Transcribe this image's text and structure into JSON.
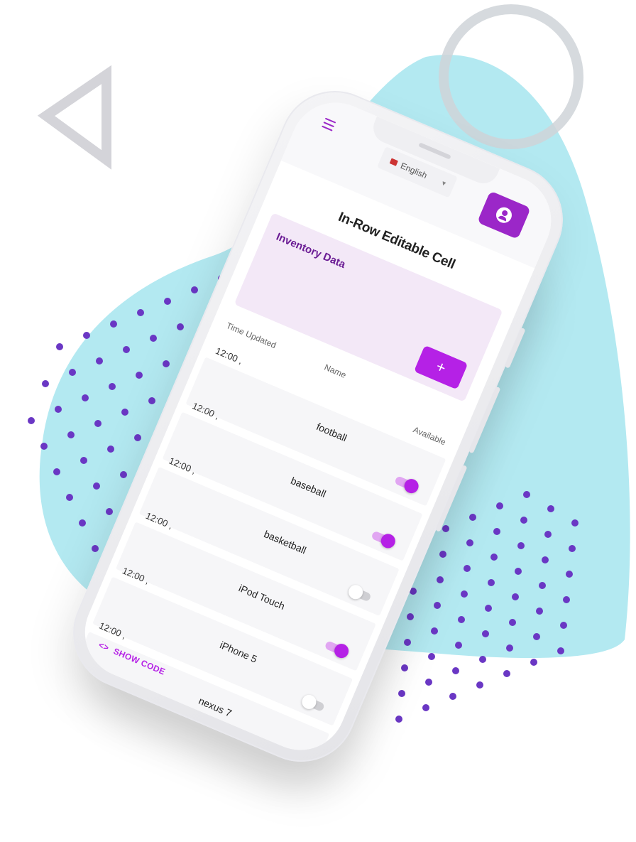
{
  "colors": {
    "accent": "#b521e6",
    "accent_dark": "#9b27c8",
    "header_bg": "#f3e8f7",
    "blob": "#b3e9f1",
    "dots": "#6a37c4",
    "ring": "#cfd4d8",
    "triangle": "#d4d4d9"
  },
  "header": {
    "menu_icon": "hamburger-menu-icon",
    "language": "English",
    "profile_icon": "user-profile-icon"
  },
  "page": {
    "title": "In-Row Editable Cell"
  },
  "card": {
    "title": "Inventory Data",
    "add_label": "+"
  },
  "table": {
    "columns": [
      "Time Updated",
      "Name",
      "Available"
    ],
    "rows": [
      {
        "time": "12:00 ,",
        "name": "football",
        "available": true
      },
      {
        "time": "12:00 ,",
        "name": "baseball",
        "available": true
      },
      {
        "time": "12:00 ,",
        "name": "basketball",
        "available": false
      },
      {
        "time": "12:00 ,",
        "name": "iPod Touch",
        "available": true
      },
      {
        "time": "12:00 ,",
        "name": "iPhone 5",
        "available": false
      },
      {
        "time": "12:00 ,",
        "name": "nexus 7",
        "available": true
      }
    ]
  },
  "footer": {
    "show_code_label": "SHOW CODE",
    "code_icon": "<>"
  }
}
